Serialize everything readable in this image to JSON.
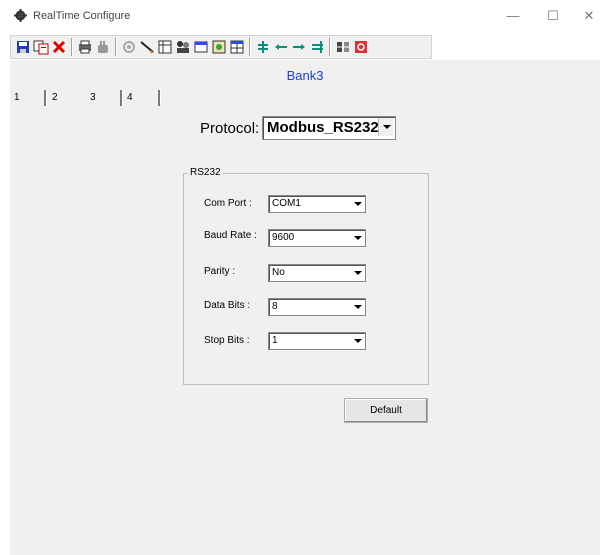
{
  "window": {
    "title": "RealTime Configure",
    "min": "—",
    "max": "☐",
    "close": "✕"
  },
  "toolbar": {
    "icons": [
      "save-icon",
      "copy-icon",
      "delete-icon",
      "print-icon",
      "hand-icon",
      "puzzle-icon",
      "pen-icon",
      "table-icon",
      "people-icon",
      "window-icon",
      "map-icon",
      "grid-icon",
      "align-center-icon",
      "arrow-left-icon",
      "arrow-right-icon",
      "align-right-icon",
      "tools-icon",
      "stop-icon"
    ]
  },
  "bank": {
    "title": "Bank3"
  },
  "tabs": [
    {
      "label": "1",
      "active": false
    },
    {
      "label": "2",
      "active": false
    },
    {
      "label": "3",
      "active": true
    },
    {
      "label": "4",
      "active": false
    }
  ],
  "protocol": {
    "label": "Protocol:",
    "value": "Modbus_RS232"
  },
  "rs232": {
    "title": "RS232",
    "fields": [
      {
        "label": "Com Port :",
        "value": "COM1"
      },
      {
        "label": "Baud Rate :",
        "value": "9600"
      },
      {
        "label": "Parity :",
        "value": "No"
      },
      {
        "label": "Data Bits :",
        "value": "8"
      },
      {
        "label": "Stop Bits :",
        "value": "1"
      }
    ]
  },
  "buttons": {
    "default_label": "Default"
  }
}
